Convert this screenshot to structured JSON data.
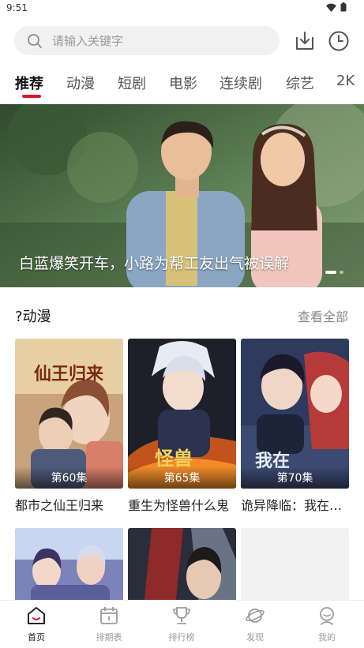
{
  "status_bar": {
    "time": "9:51"
  },
  "search": {
    "placeholder": "请输入关键字"
  },
  "header_icons": [
    "download-icon",
    "history-clock-icon"
  ],
  "tabs": [
    {
      "label": "推荐",
      "active": true
    },
    {
      "label": "动漫"
    },
    {
      "label": "短剧"
    },
    {
      "label": "电影"
    },
    {
      "label": "连续剧"
    },
    {
      "label": "综艺"
    },
    {
      "label": "2K"
    }
  ],
  "banner": {
    "caption": "白蓝爆笑开车，小路为帮工友出气被误解",
    "slide_count": 2,
    "active_slide": 1
  },
  "section": {
    "title": "?动漫",
    "more": "查看全部",
    "items": [
      {
        "title": "都市之仙王归来",
        "episode": "第60集",
        "poster_text": "仙王归来"
      },
      {
        "title": "重生为怪兽什么鬼",
        "episode": "第65集",
        "poster_text": "怪兽"
      },
      {
        "title": "诡异降临：我在…",
        "episode": "第70集",
        "poster_text": "我在"
      },
      {
        "title": "",
        "episode": ""
      },
      {
        "title": "",
        "episode": ""
      },
      {
        "title": "",
        "episode": ""
      }
    ]
  },
  "bottom_nav": [
    {
      "label": "首页",
      "icon": "home-icon",
      "active": true
    },
    {
      "label": "排期表",
      "icon": "calendar-icon"
    },
    {
      "label": "排行榜",
      "icon": "trophy-icon"
    },
    {
      "label": "发现",
      "icon": "planet-icon"
    },
    {
      "label": "我的",
      "icon": "profile-icon"
    }
  ],
  "colors": {
    "accent": "#d5192c",
    "inactive": "#9a9a9a"
  }
}
